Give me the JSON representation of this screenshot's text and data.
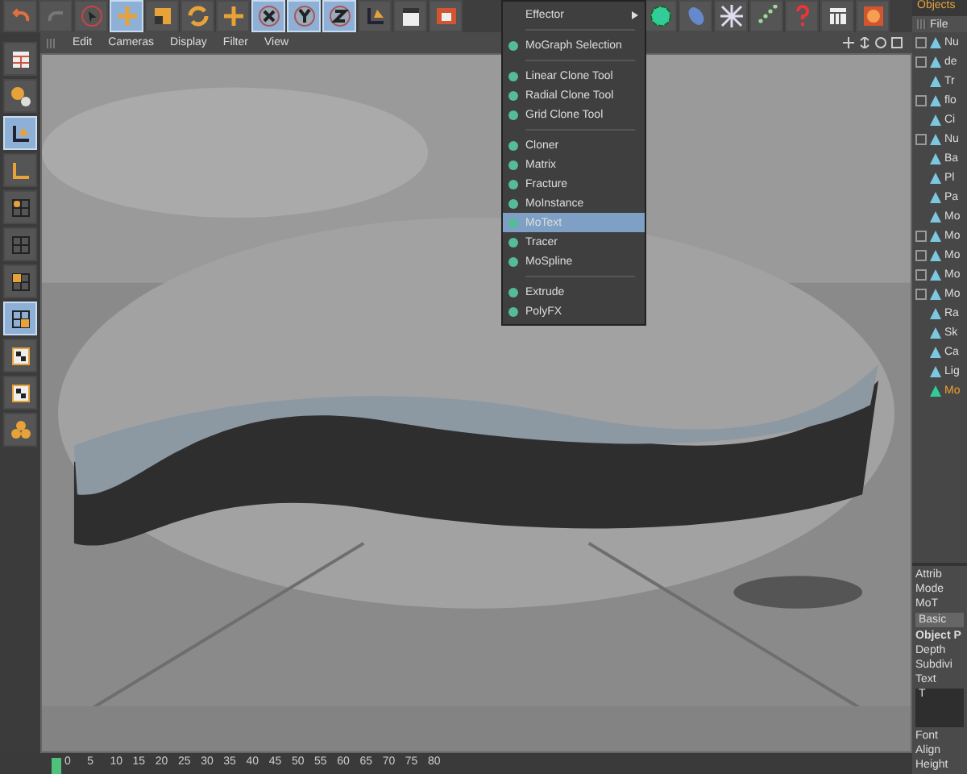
{
  "toolbar": [
    {
      "kind": "undo",
      "selected": false
    },
    {
      "kind": "redo",
      "selected": false
    },
    {
      "kind": "select",
      "selected": false
    },
    {
      "kind": "move",
      "selected": true
    },
    {
      "kind": "scale",
      "selected": false
    },
    {
      "kind": "rotate",
      "selected": false
    },
    {
      "kind": "plus",
      "selected": false
    },
    {
      "kind": "x",
      "selected": true
    },
    {
      "kind": "y",
      "selected": true
    },
    {
      "kind": "z",
      "selected": true
    },
    {
      "kind": "axis",
      "selected": false
    },
    {
      "kind": "clapper",
      "selected": false
    },
    {
      "kind": "render",
      "selected": false
    }
  ],
  "toolbar_right": [
    {
      "kind": "flower",
      "selected": false
    },
    {
      "kind": "pill",
      "selected": false
    },
    {
      "kind": "burst",
      "selected": false
    },
    {
      "kind": "dots",
      "selected": false
    },
    {
      "kind": "help",
      "selected": false
    },
    {
      "kind": "calendar",
      "selected": false
    },
    {
      "kind": "globe",
      "selected": false
    }
  ],
  "left_toolbar": [
    {
      "kind": "layout",
      "selected": false
    },
    {
      "kind": "spheres",
      "selected": false
    },
    {
      "kind": "axis",
      "selected": true
    },
    {
      "kind": "axis2",
      "selected": false
    },
    {
      "kind": "grid",
      "selected": false
    },
    {
      "kind": "grid2",
      "selected": false
    },
    {
      "kind": "grid3",
      "selected": false
    },
    {
      "kind": "grid4",
      "selected": true
    },
    {
      "kind": "checker",
      "selected": false
    },
    {
      "kind": "checker2",
      "selected": false
    },
    {
      "kind": "blob",
      "selected": false
    }
  ],
  "viewport_menu": [
    "Edit",
    "Cameras",
    "Display",
    "Filter",
    "View"
  ],
  "dropdown": [
    {
      "kind": "submenu",
      "label": "Effector",
      "selected": false
    },
    {
      "kind": "separator"
    },
    {
      "kind": "item",
      "label": "MoGraph Selection",
      "selected": false
    },
    {
      "kind": "separator"
    },
    {
      "kind": "item",
      "label": "Linear Clone Tool",
      "selected": false
    },
    {
      "kind": "item",
      "label": "Radial Clone Tool",
      "selected": false
    },
    {
      "kind": "item",
      "label": "Grid Clone Tool",
      "selected": false
    },
    {
      "kind": "separator"
    },
    {
      "kind": "item",
      "label": "Cloner",
      "selected": false
    },
    {
      "kind": "item",
      "label": "Matrix",
      "selected": false
    },
    {
      "kind": "item",
      "label": "Fracture",
      "selected": false
    },
    {
      "kind": "item",
      "label": "MoInstance",
      "selected": false
    },
    {
      "kind": "item",
      "label": "MoText",
      "selected": true
    },
    {
      "kind": "item",
      "label": "Tracer",
      "selected": false
    },
    {
      "kind": "item",
      "label": "MoSpline",
      "selected": false
    },
    {
      "kind": "separator"
    },
    {
      "kind": "item",
      "label": "Extrude",
      "selected": false
    },
    {
      "kind": "item",
      "label": "PolyFX",
      "selected": false
    }
  ],
  "objects_panel": {
    "title": "Objects",
    "menu": "File",
    "items": [
      {
        "name": "Nu",
        "kind": "group",
        "selected": false
      },
      {
        "name": "de",
        "kind": "group",
        "selected": false
      },
      {
        "name": "Tr",
        "kind": "leaf",
        "selected": false
      },
      {
        "name": "flo",
        "kind": "group",
        "selected": false
      },
      {
        "name": "Ci",
        "kind": "leaf",
        "selected": false
      },
      {
        "name": "Nu",
        "kind": "group",
        "selected": false
      },
      {
        "name": "Ba",
        "kind": "leaf",
        "selected": false
      },
      {
        "name": "Pl",
        "kind": "leaf",
        "selected": false
      },
      {
        "name": "Pa",
        "kind": "leaf",
        "selected": false
      },
      {
        "name": "Mo",
        "kind": "leaf",
        "selected": false
      },
      {
        "name": "Mo",
        "kind": "group",
        "selected": false
      },
      {
        "name": "Mo",
        "kind": "group",
        "selected": false
      },
      {
        "name": "Mo",
        "kind": "group",
        "selected": false
      },
      {
        "name": "Mo",
        "kind": "group",
        "selected": false
      },
      {
        "name": "Ra",
        "kind": "leaf",
        "selected": false
      },
      {
        "name": "Sk",
        "kind": "leaf",
        "selected": false
      },
      {
        "name": "Ca",
        "kind": "leaf",
        "selected": false
      },
      {
        "name": "Lig",
        "kind": "leaf",
        "selected": false
      },
      {
        "name": "Mo",
        "kind": "leaf",
        "selected": true
      }
    ]
  },
  "attributes_panel": {
    "title": "Attrib",
    "menu": "Mode",
    "object": "MoT",
    "tab": "Basic",
    "section": "Object P",
    "fields": [
      "Depth",
      "Subdivi"
    ],
    "text_label": "Text",
    "text_value": "T",
    "fields_below": [
      "Font",
      "Align",
      "Height"
    ]
  },
  "timeline": {
    "ticks": [
      "0",
      "5",
      "10",
      "15",
      "20",
      "25",
      "30",
      "35",
      "40",
      "45",
      "50",
      "55",
      "60",
      "65",
      "70",
      "75",
      "80"
    ]
  }
}
